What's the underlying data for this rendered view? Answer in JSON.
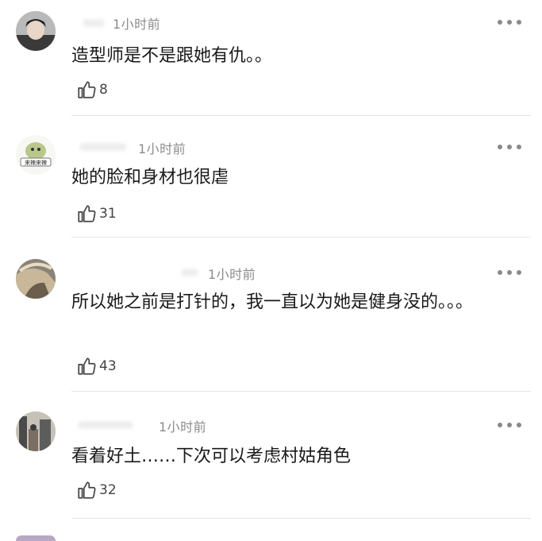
{
  "comments": [
    {
      "time": "1小时前",
      "text": "造型师是不是跟她有仇。。",
      "likes": "8"
    },
    {
      "time": "1小时前",
      "text": "她的脸和身材也很虐",
      "likes": "31",
      "avatar_label": "来辣来辣"
    },
    {
      "time": "1小时前",
      "text": "所以她之前是打针的，我一直以为她是健身没的。。。",
      "likes": "43"
    },
    {
      "time": "1小时前",
      "text": "看着好土……下次可以考虑村姑角色",
      "likes": "32"
    }
  ]
}
